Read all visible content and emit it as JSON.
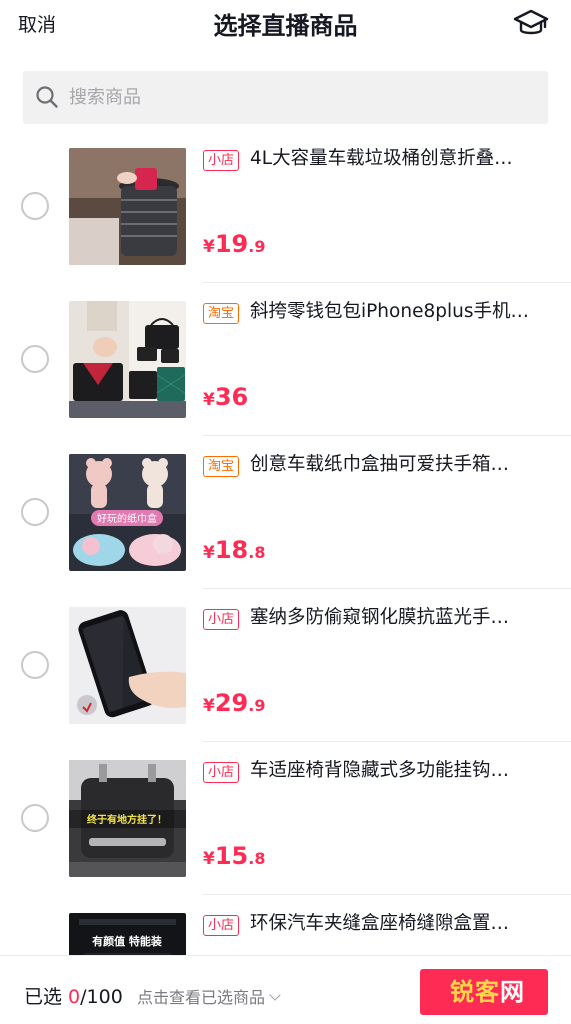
{
  "header": {
    "cancel_label": "取消",
    "title": "选择直播商品",
    "help_icon": "graduation-cap-icon"
  },
  "search": {
    "placeholder": "搜索商品",
    "icon": "search-icon"
  },
  "products": [
    {
      "tag": "小店",
      "tag_color": "#fe2c55",
      "name": "4L大容量车载垃圾桶创意折叠…",
      "price_symbol": "¥",
      "price_int": "19",
      "price_dec": ".9",
      "selected": false,
      "thumb_icon": "car-trash-bin-image"
    },
    {
      "tag": "淘宝",
      "tag_color": "#ff6a00",
      "name": "斜挎零钱包包iPhone8plus手机…",
      "price_symbol": "¥",
      "price_int": "36",
      "price_dec": "",
      "selected": false,
      "thumb_icon": "phone-bag-image"
    },
    {
      "tag": "淘宝",
      "tag_color": "#ff6a00",
      "name": "创意车载纸巾盒抽可爱扶手箱…",
      "price_symbol": "¥",
      "price_int": "18",
      "price_dec": ".8",
      "selected": false,
      "thumb_icon": "plush-tissue-box-image",
      "thumb_caption": "好玩的纸巾盒"
    },
    {
      "tag": "小店",
      "tag_color": "#fe2c55",
      "name": "塞纳多防偷窥钢化膜抗蓝光手…",
      "price_symbol": "¥",
      "price_int": "29",
      "price_dec": ".9",
      "selected": false,
      "thumb_icon": "privacy-screen-protector-image"
    },
    {
      "tag": "小店",
      "tag_color": "#fe2c55",
      "name": "车适座椅背隐藏式多功能挂钩…",
      "price_symbol": "¥",
      "price_int": "15",
      "price_dec": ".8",
      "selected": false,
      "thumb_icon": "seat-hook-image",
      "thumb_caption": "终于有地方挂了！"
    },
    {
      "tag": "小店",
      "tag_color": "#fe2c55",
      "name": "环保汽车夹缝盒座椅缝隙盒置…",
      "price_symbol": "",
      "price_int": "",
      "price_dec": "",
      "selected": false,
      "thumb_icon": "seat-gap-box-image",
      "thumb_caption": "有颜值 特能装"
    }
  ],
  "footer": {
    "selected_prefix": "已选 ",
    "selected_count": "0",
    "selected_total": "/100",
    "view_selected_label": "点击查看已选商品",
    "confirm_label": ""
  },
  "watermark": {
    "part1": "锐客",
    "part2": "网"
  },
  "colors": {
    "accent": "#fe2c55",
    "taobao": "#ff6a00",
    "text": "#161823",
    "muted": "#a6a7ab"
  }
}
